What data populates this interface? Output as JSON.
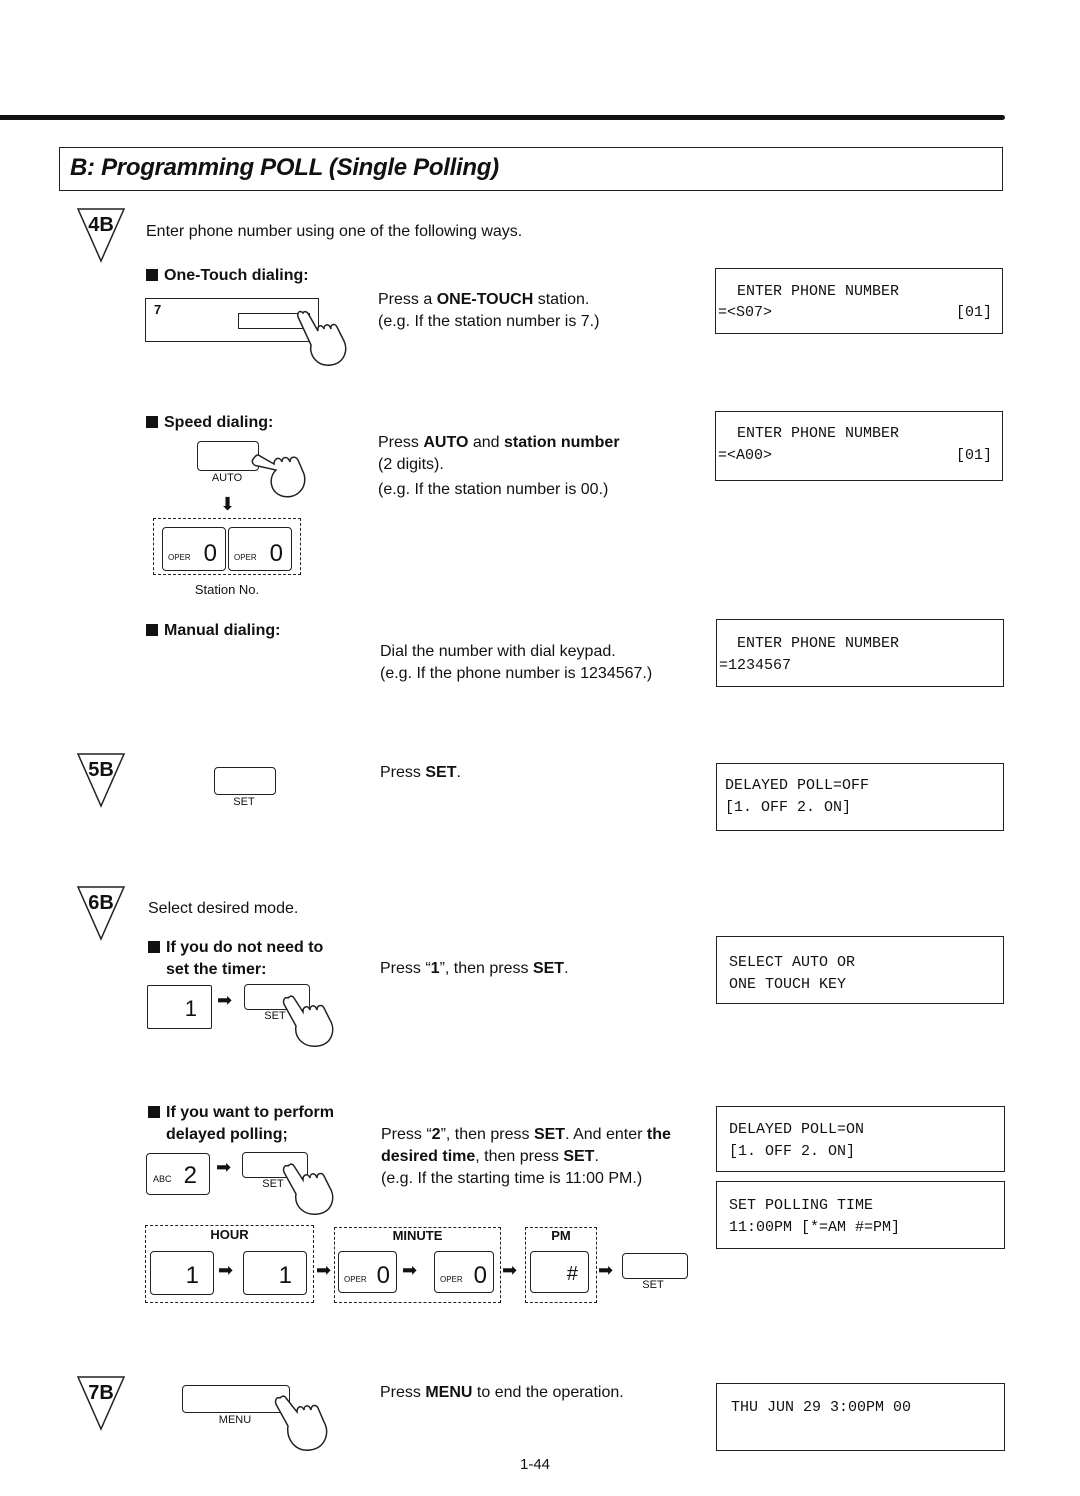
{
  "header": {
    "title": "B:  Programming POLL (Single Polling)"
  },
  "steps": {
    "s4b": {
      "badge": "4B",
      "intro": "Enter phone number using one of the following ways.",
      "one_touch": {
        "heading": "One-Touch dialing:",
        "station_label": "7",
        "line1_pre": "Press a ",
        "line1_bold": "ONE-TOUCH",
        "line1_post": " station.",
        "line2": "(e.g. If the station number is 7.)",
        "lcd": [
          "ENTER PHONE NUMBER",
          "=<S07>",
          "[01]"
        ]
      },
      "speed": {
        "heading": "Speed dialing:",
        "key_label": "AUTO",
        "oper_label": "OPER",
        "digit1": "0",
        "digit2": "0",
        "station_caption": "Station No.",
        "line1_pre": "Press ",
        "line1_bold1": "AUTO",
        "line1_mid": " and ",
        "line1_bold2": "station number",
        "line2": "(2 digits).",
        "line3": "(e.g. If the station number is 00.)",
        "lcd": [
          "ENTER PHONE NUMBER",
          "=<A00>",
          "[01]"
        ]
      },
      "manual": {
        "heading": "Manual dialing:",
        "line1": "Dial the number with dial keypad.",
        "line2": "(e.g. If the phone number is 1234567.)",
        "lcd": [
          "ENTER PHONE NUMBER",
          "=1234567"
        ]
      }
    },
    "s5b": {
      "badge": "5B",
      "key_label": "SET",
      "text_pre": "Press ",
      "text_bold": "SET",
      "text_post": ".",
      "lcd": [
        "DELAYED POLL=OFF",
        "[1. OFF 2. ON]"
      ]
    },
    "s6b": {
      "badge": "6B",
      "intro": "Select desired mode.",
      "no_timer": {
        "heading1": "If you do not need to",
        "heading2": "set the timer:",
        "key_digit": "1",
        "key_label": "SET",
        "text_pre": "Press “",
        "text_b1": "1",
        "text_mid": "”, then press ",
        "text_b2": "SET",
        "text_post": ".",
        "lcd": [
          "SELECT AUTO OR",
          "ONE TOUCH KEY"
        ]
      },
      "delayed": {
        "heading1": "If you want to perform",
        "heading2": "delayed polling;",
        "key_abc": "ABC",
        "key_digit": "2",
        "key_label": "SET",
        "l1_pre": "Press “",
        "l1_b1": "2",
        "l1_mid": "”, then press ",
        "l1_b2": "SET",
        "l1_mid2": ". And enter ",
        "l1_b3": "the",
        "l2_b": "desired time",
        "l2_mid": ", then press ",
        "l2_b2": "SET",
        "l2_post": ".",
        "l3": "(e.g. If the starting time is 11:00 PM.)",
        "lcd1": [
          "DELAYED POLL=ON",
          "[1. OFF 2. ON]"
        ],
        "lcd2": [
          "SET POLLING TIME",
          "11:00PM [*=AM #=PM]"
        ],
        "hour_label": "HOUR",
        "minute_label": "MINUTE",
        "pm_label": "PM",
        "hour_d1": "1",
        "hour_d2": "1",
        "oper_label": "OPER",
        "min_d1": "0",
        "min_d2": "0",
        "pm_key": "#",
        "set_label": "SET"
      }
    },
    "s7b": {
      "badge": "7B",
      "key_label": "MENU",
      "text_pre": "Press ",
      "text_bold": "MENU",
      "text_post": " to end the operation.",
      "lcd": [
        "THU JUN 29 3:00PM 00"
      ]
    }
  },
  "footer": {
    "page_number": "1-44"
  }
}
